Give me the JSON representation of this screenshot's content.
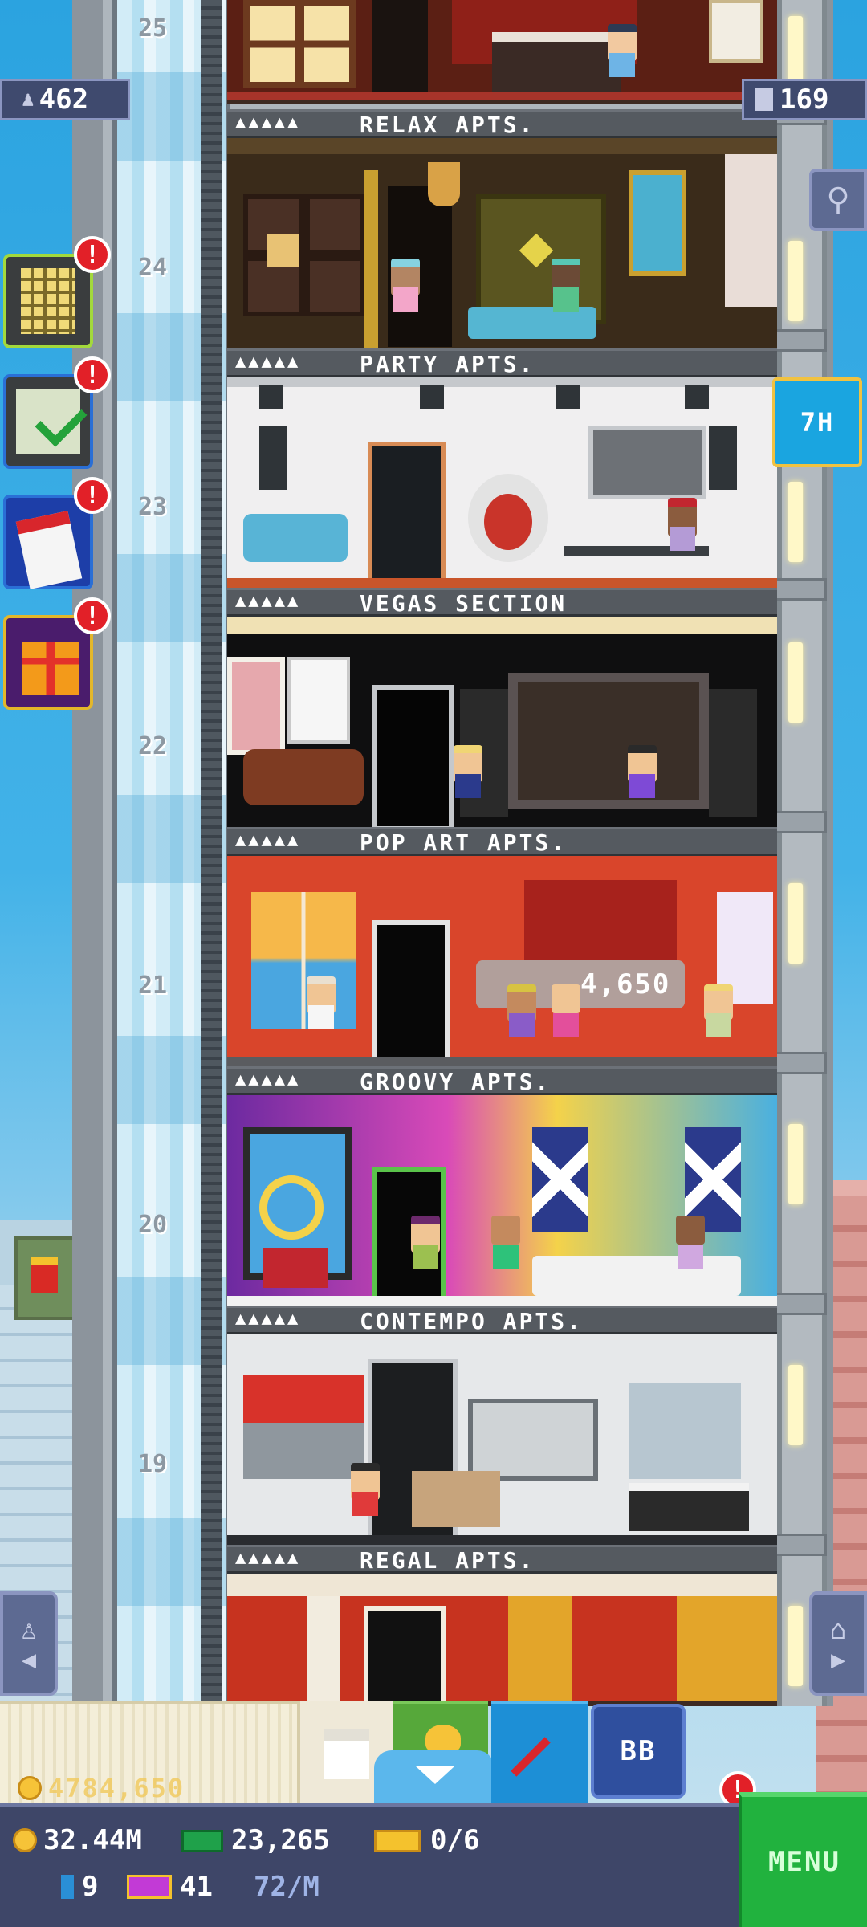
{
  "hud": {
    "population": "462",
    "floors": "169",
    "timer_button": "7H",
    "notification_mark": "!",
    "coins_floating": "4784,650",
    "center_popup_value": "4,650"
  },
  "floors": [
    {
      "number": "25",
      "label": "RELAX APTS.",
      "stars": "▲▲▲▲▲"
    },
    {
      "number": "24",
      "label": "PARTY APTS.",
      "stars": "▲▲▲▲▲"
    },
    {
      "number": "23",
      "label": "VEGAS SECTION",
      "stars": "▲▲▲▲▲"
    },
    {
      "number": "22",
      "label": "POP ART APTS.",
      "stars": "▲▲▲▲▲"
    },
    {
      "number": "21",
      "label": "GROOVY APTS.",
      "stars": "▲▲▲▲▲"
    },
    {
      "number": "20",
      "label": "CONTEMPO APTS.",
      "stars": "▲▲▲▲▲"
    },
    {
      "number": "19",
      "label": "REGAL APTS.",
      "stars": "▲▲▲▲▲"
    }
  ],
  "toolbar": {
    "bb_label": "BB"
  },
  "status": {
    "coins": "32.44M",
    "bux": "23,265",
    "tickets": "0/6",
    "keys": "9",
    "vip": "41",
    "rate": "72/M"
  },
  "menu": {
    "label": "MENU"
  },
  "colors": {
    "menu_green": "#21b23e",
    "status_bar": "#3e4668",
    "badge_red": "#e22028",
    "timer_blue": "#1aa5e0"
  },
  "icons": [
    "population-icon",
    "floors-icon",
    "search-icon",
    "calendar-icon",
    "checklist-icon",
    "gift-icon",
    "building-icon",
    "elevator-left-icon",
    "home-right-icon",
    "box-icon",
    "rocket-icon",
    "coin-icon",
    "bux-icon",
    "ticket-icon",
    "key-icon",
    "vip-icon"
  ]
}
